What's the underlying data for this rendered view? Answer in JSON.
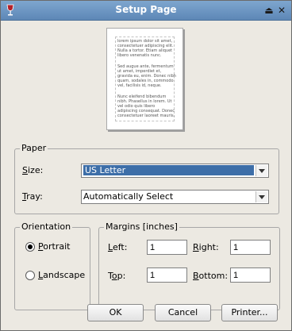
{
  "window": {
    "title": "Setup Page",
    "controls": {
      "shade": "⏏",
      "close": "✕"
    }
  },
  "preview": {
    "paragraphs": [
      "lorem ipsum dolor sit amet, consectetuer adipiscing elit. Nulla a tortor. Etiam aliquet libero venenatis nunc.",
      "Sed augue ante, fermentum ut amet, imperdiet et, gravida eu, enim. Donec nibh quam, sodales in, commodo vel, facilisis id, neque.",
      "Nunc eleifend bibendum nibh. Phasellus in lorem. Ut vel odio quis libero adipiscing consequat. Donec consectetuer laoreet mauris."
    ]
  },
  "paper": {
    "legend": "Paper",
    "size_label": "Size:",
    "size_value": "US Letter",
    "tray_label": "Tray:",
    "tray_value": "Automatically Select"
  },
  "orientation": {
    "legend": "Orientation",
    "portrait": "Portrait",
    "landscape": "Landscape",
    "selected": "Portrait"
  },
  "margins": {
    "legend": "Margins [inches]",
    "left_label": "Left:",
    "left_value": "1",
    "right_label": "Right:",
    "right_value": "1",
    "top_label": "Top:",
    "top_value": "1",
    "bottom_label": "Bottom:",
    "bottom_value": "1"
  },
  "buttons": {
    "ok": "OK",
    "cancel": "Cancel",
    "printer": "Printer..."
  }
}
